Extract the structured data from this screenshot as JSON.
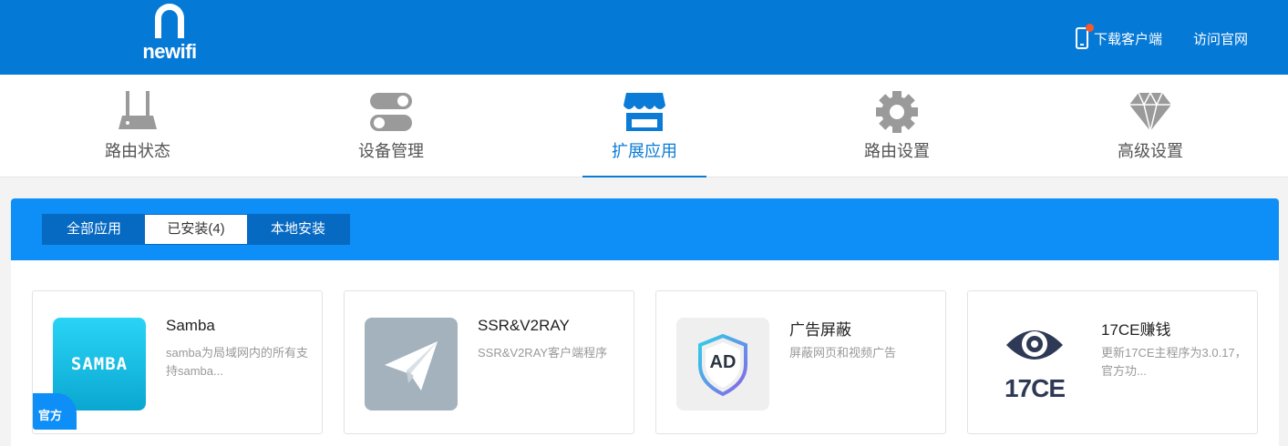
{
  "header": {
    "logo_text": "newifi",
    "download_label": "下载客户端",
    "visit_label": "访问官网"
  },
  "nav": {
    "items": [
      {
        "label": "路由状态",
        "icon": "router-icon"
      },
      {
        "label": "设备管理",
        "icon": "toggles-icon"
      },
      {
        "label": "扩展应用",
        "icon": "store-icon",
        "active": true
      },
      {
        "label": "路由设置",
        "icon": "gear-icon"
      },
      {
        "label": "高级设置",
        "icon": "diamond-icon"
      }
    ]
  },
  "subtabs": [
    {
      "label": "全部应用"
    },
    {
      "label": "已安装(4)",
      "active": true
    },
    {
      "label": "本地安装"
    }
  ],
  "apps": [
    {
      "name": "Samba",
      "desc": "samba为局域网内的所有支持samba...",
      "icon_text": "SAMBA",
      "badge": "官方"
    },
    {
      "name": "SSR&V2RAY",
      "desc": "SSR&V2RAY客户端程序",
      "icon": "paper-plane-icon"
    },
    {
      "name": "广告屏蔽",
      "desc": "屏蔽网页和视频广告",
      "icon_text": "AD"
    },
    {
      "name": "17CE赚钱",
      "desc": "更新17CE主程序为3.0.17，官方功...",
      "icon_text": "17CE"
    }
  ],
  "colors": {
    "header_bg": "#0579d6",
    "accent": "#0a7bd6",
    "panel_head": "#0e8ef7"
  }
}
